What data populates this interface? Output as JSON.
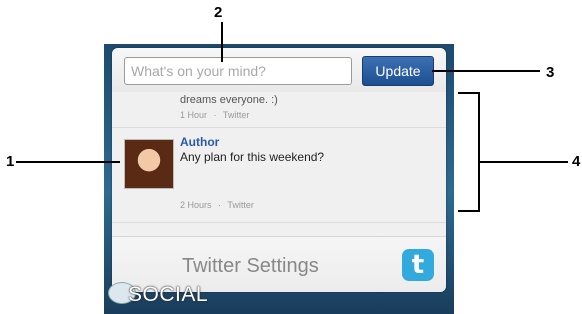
{
  "callouts": [
    "1",
    "2",
    "3",
    "4"
  ],
  "widget": {
    "status_placeholder": "What's on your mind?",
    "update_label": "Update",
    "feed": [
      {
        "text": "dreams everyone. :)",
        "time": "1 Hour",
        "source": "Twitter"
      },
      {
        "author": "Author",
        "text": "Any plan for this weekend?",
        "time": "2 Hours",
        "source": "Twitter"
      }
    ],
    "meta_separator": "·",
    "settings_label": "Twitter Settings",
    "twitter_icon": "twitter-icon",
    "social_label": "SOCIAL"
  }
}
